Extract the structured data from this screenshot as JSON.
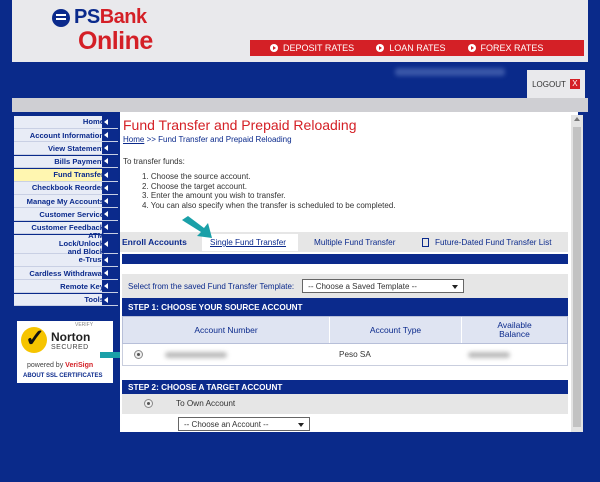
{
  "brand": {
    "ps": "PS",
    "bank": "Bank",
    "online": "Online"
  },
  "rates": [
    {
      "label": "DEPOSIT RATES"
    },
    {
      "label": "LOAN RATES"
    },
    {
      "label": "FOREX RATES"
    }
  ],
  "logout": {
    "label": "LOGOUT",
    "x": "X"
  },
  "sidebar": {
    "items": [
      {
        "label": "Home"
      },
      {
        "label": "Account Information"
      },
      {
        "label": "View Statement"
      },
      {
        "label": "Bills Payment"
      },
      {
        "label": "Fund Transfer"
      },
      {
        "label": "Checkbook Reorder"
      },
      {
        "label": "Manage My Accounts"
      },
      {
        "label": "Customer Service"
      },
      {
        "label": "Customer Feedback"
      },
      {
        "label": "ATM Lock/Unlock and Block"
      },
      {
        "label": "e-Trust"
      },
      {
        "label": "Cardless Withdrawal"
      },
      {
        "label": "Remote Key"
      },
      {
        "label": "Tools"
      }
    ]
  },
  "norton": {
    "verify": "VERIFY",
    "name": "Norton",
    "secured": "SECURED",
    "powered": "powered by",
    "verisign": "VeriSign",
    "about": "ABOUT SSL CERTIFICATES"
  },
  "page": {
    "title": "Fund Transfer and Prepaid Reloading",
    "crumb_home": "Home",
    "crumb_rest": " >> Fund Transfer and Prepaid Reloading",
    "intro": "To transfer funds:",
    "steps": [
      "1. Choose the source account.",
      "2. Choose the target account.",
      "3. Enter the amount you wish to transfer.",
      "4. You can also specify when the transfer is scheduled to be completed."
    ]
  },
  "tabs": {
    "enroll": "Enroll Accounts",
    "single": "Single Fund Transfer",
    "multiple": "Multiple Fund Transfer",
    "future": "Future-Dated Fund Transfer List"
  },
  "template": {
    "label": "Select from the saved Fund Transfer Template:",
    "value": "-- Choose a Saved Template --"
  },
  "step1": {
    "title": "STEP 1: CHOOSE YOUR SOURCE ACCOUNT",
    "headers": [
      "Account Number",
      "Account Type",
      "Available Balance"
    ],
    "row": {
      "account_type": "Peso SA"
    }
  },
  "step2": {
    "title": "STEP 2: CHOOSE A TARGET ACCOUNT",
    "own_account": "To Own Account",
    "choose_value": "-- Choose an Account --"
  },
  "colors": {
    "brand_blue": "#0b2a8c",
    "brand_red": "#d42026",
    "annotation_arrow": "#1aa0a8"
  }
}
